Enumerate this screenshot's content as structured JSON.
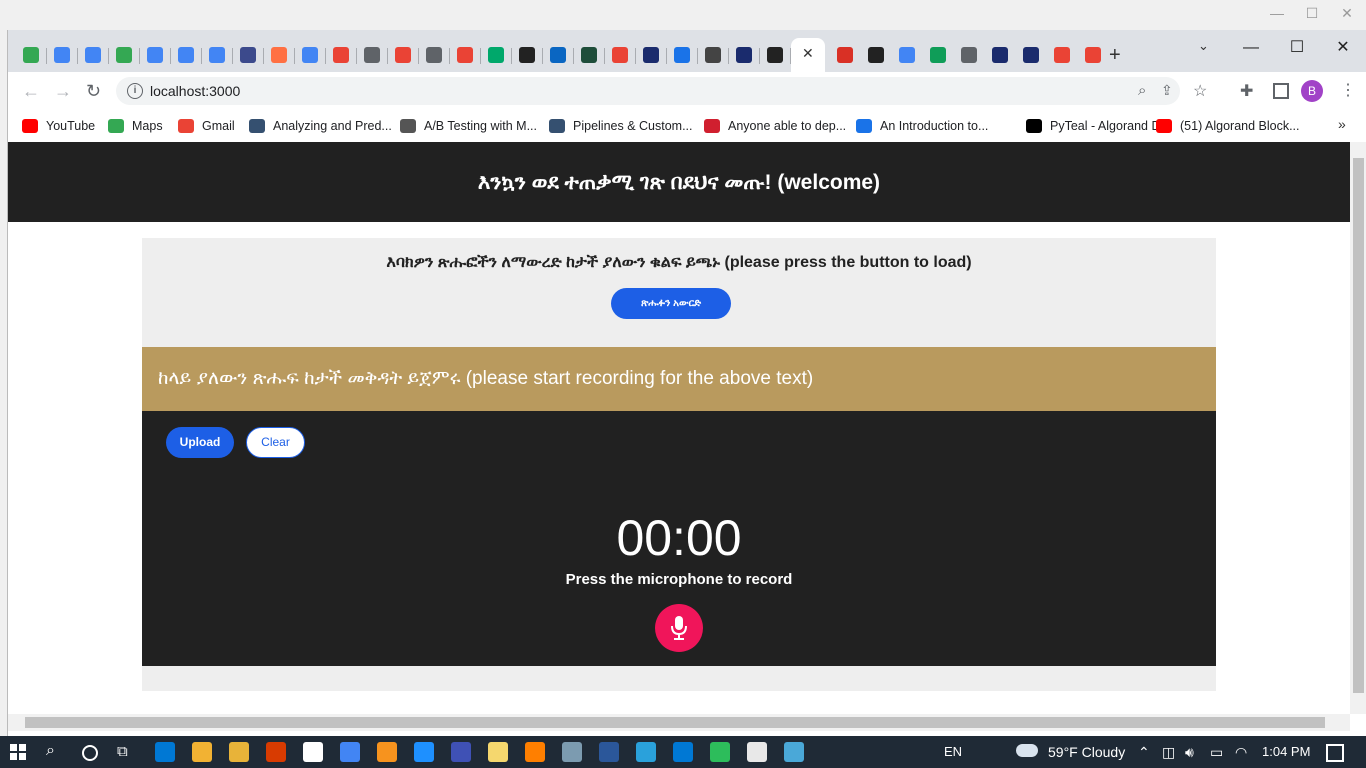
{
  "browser": {
    "url": "localhost:3000",
    "profile_initial": "B",
    "bookmarks": [
      {
        "label": "YouTube",
        "icon": "youtube-icon",
        "color": "#ff0000"
      },
      {
        "label": "Maps",
        "icon": "maps-icon",
        "color": "#34a853"
      },
      {
        "label": "Gmail",
        "icon": "gmail-icon",
        "color": "#ea4335"
      },
      {
        "label": "Analyzing and Pred...",
        "icon": "tds-icon",
        "color": "#355070"
      },
      {
        "label": "A/B Testing with M...",
        "icon": "ab-icon",
        "color": "#555555"
      },
      {
        "label": "Pipelines & Custom...",
        "icon": "tds-icon",
        "color": "#355070"
      },
      {
        "label": "Anyone able to dep...",
        "icon": "crown-icon",
        "color": "#d01f2f"
      },
      {
        "label": "An Introduction to...",
        "icon": "fingerprint-icon",
        "color": "#1a73e8"
      },
      {
        "label": "PyTeal - Algorand D...",
        "icon": "algorand-icon",
        "color": "#000000"
      },
      {
        "label": "(51) Algorand Block...",
        "icon": "youtube-icon",
        "color": "#ff0000"
      }
    ]
  },
  "page": {
    "header_title": "እንኳን ወደ ተጠቃሚ ገጽ በደህና መጡ! (welcome)",
    "load_prompt": "እባክዎን ጽሑፎችን ለማውረድ ከታች ያለውን ቁልፍ ይጫኑ (please press the button to load)",
    "load_button": "ጽሑፉን አውርድ",
    "record_prompt": "ከላይ ያለውን ጽሑፍ ከታች መቅዳት ይጀምሩ (please start recording for the above text)",
    "upload_button": "Upload",
    "clear_button": "Clear",
    "timer": "00:00",
    "mic_hint": "Press the microphone to record"
  },
  "taskbar": {
    "language": "EN",
    "weather": "59°F  Cloudy",
    "time": "1:04 PM"
  },
  "colors": {
    "header_bg": "#212121",
    "accent_blue": "#1d5fe6",
    "gold_banner": "#b99a5e",
    "mic_pink": "#f0155a"
  }
}
